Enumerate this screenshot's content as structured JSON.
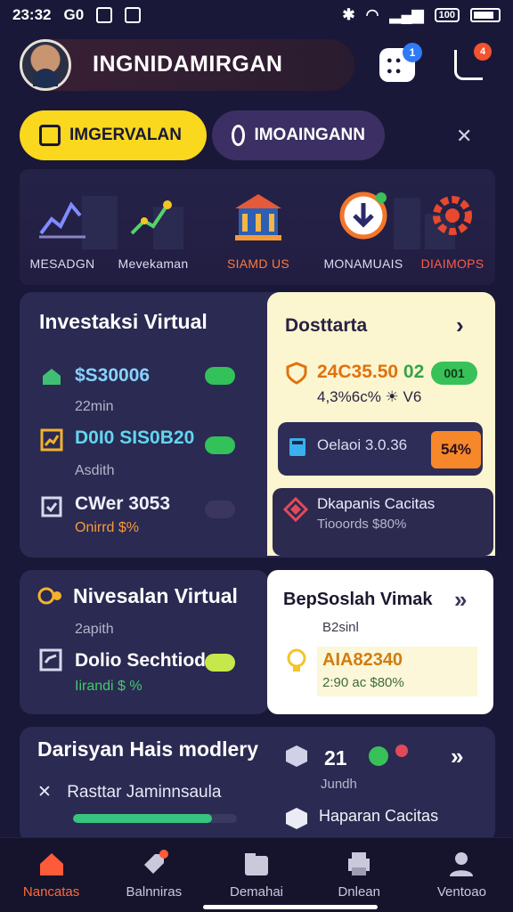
{
  "status_bar": {
    "time": "23:32",
    "carrier": "G0",
    "battery_label": "100"
  },
  "header": {
    "username": "INGNIDAMIRGAN",
    "notif_count": "1",
    "music_badge": "4"
  },
  "tabs": [
    {
      "label": "IMGERVALAN",
      "active": true
    },
    {
      "label": "IMOAINGANN",
      "active": false
    }
  ],
  "categories": [
    {
      "label": "MESADGN",
      "icon": "line-chart-icon"
    },
    {
      "label": "Mevekaman",
      "icon": "growth-chart-icon"
    },
    {
      "label": "SIAMD US",
      "icon": "bank-building-icon",
      "active": true
    },
    {
      "label": "MONAMUAIS",
      "icon": "download-circle-icon"
    },
    {
      "label": "DIAIMOPS",
      "icon": "gear-icon"
    }
  ],
  "investasi_card": {
    "title": "Investaksi Virtual",
    "rows": [
      {
        "value": "$S30006",
        "sub": "22min",
        "icon": "piggy-bank-icon"
      },
      {
        "value": "D0I0 SIS0B20",
        "sub": "Asdith",
        "icon": "chart-box-icon"
      },
      {
        "value": "CWer 3053",
        "sub": "Onirrd $%",
        "icon": "clipboard-icon"
      }
    ]
  },
  "dostarta_card": {
    "title": "Dosttarta",
    "value": "24C35.50",
    "value_suffix": "02",
    "pill": "001",
    "sub": "4,3%6c% ☀ V6",
    "mini": {
      "label": "Oelaoi 3.0.36",
      "badge": "54%"
    },
    "kapanis": {
      "title": "Dkapanis Cacitas",
      "sub": "Tiooords $80%"
    }
  },
  "nivesalan_card": {
    "title": "Nivesalan Virtual",
    "sub": "2apith",
    "value": "Dolio Sechtiod",
    "foot": "Iirandi $ %"
  },
  "besoslah_card": {
    "title": "BepSoslah Vimak",
    "sub": "B2sinl",
    "value": "AIA82340",
    "foot": "2:90 ac $80%"
  },
  "daisyan_card": {
    "title": "Darisyan Hais modlery",
    "row": "Rasttar Jaminnsaula",
    "progress": 0.85,
    "stat_num": "21",
    "stat_sub": "Jundh",
    "hapa": "Haparan Cacitas"
  },
  "bottom_nav": [
    {
      "label": "Nancatas",
      "icon": "home-icon",
      "active": true
    },
    {
      "label": "Balnniras",
      "icon": "tag-icon",
      "active": false
    },
    {
      "label": "Demahai",
      "icon": "folder-icon",
      "active": false
    },
    {
      "label": "Dnlean",
      "icon": "printer-icon",
      "active": false
    },
    {
      "label": "Ventoao",
      "icon": "person-icon",
      "active": false
    }
  ]
}
